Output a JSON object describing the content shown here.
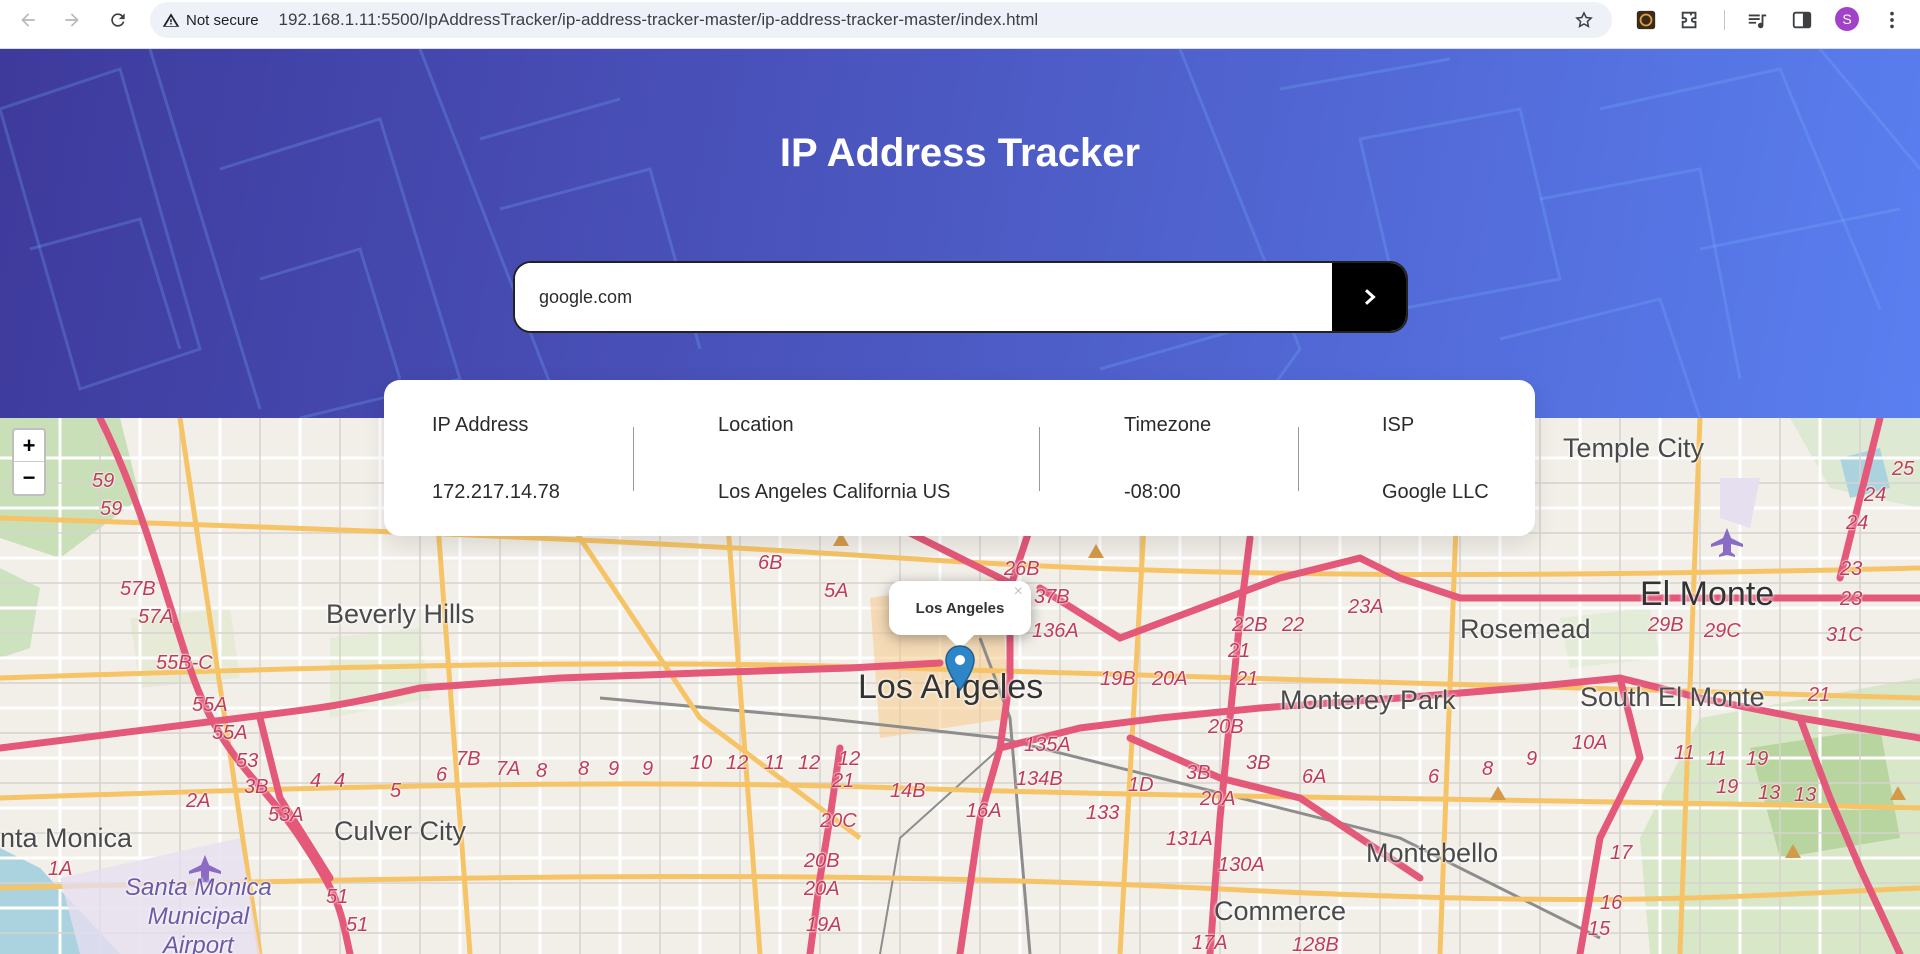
{
  "browser": {
    "security_text": "Not secure",
    "url": "192.168.1.11:5500/IpAddressTracker/ip-address-tracker-master/ip-address-tracker-master/index.html",
    "profile_initial": "S"
  },
  "header": {
    "title": "IP Address Tracker"
  },
  "search": {
    "value": "google.com"
  },
  "info": {
    "ip_label": "IP Address",
    "ip_value": "172.217.14.78",
    "location_label": "Location",
    "location_value": "Los Angeles California US",
    "timezone_label": "Timezone",
    "timezone_value": "-08:00",
    "isp_label": "ISP",
    "isp_value": "Google LLC"
  },
  "map": {
    "zoom_in": "+",
    "zoom_out": "−",
    "popup_text": "Los Angeles",
    "popup_close": "×",
    "places": {
      "beverly_hills": "Beverly Hills",
      "los_angeles": "Los Angeles",
      "culver_city": "Culver City",
      "santa_monica": "nta Monica",
      "smo_airport_1": "Santa Monica",
      "smo_airport_2": "Municipal",
      "smo_airport_3": "Airport",
      "monterey_park": "Monterey Park",
      "rosemead": "Rosemead",
      "el_monte": "El Monte",
      "south_el_monte": "South El Monte",
      "temple_city": "Temple City",
      "montebello": "Montebello",
      "commerce": "Commerce"
    },
    "road_labels": [
      "59",
      "59",
      "57B",
      "57A",
      "55B-C",
      "55A",
      "55A",
      "53",
      "3B",
      "53A",
      "2A",
      "1A",
      "4",
      "4",
      "5",
      "6",
      "7B",
      "7A",
      "8",
      "8",
      "9",
      "9",
      "10",
      "12",
      "11",
      "12",
      "12",
      "21",
      "6B",
      "5A",
      "26B",
      "37B",
      "136A",
      "14B",
      "20C",
      "20B",
      "20A",
      "19A",
      "16A",
      "135A",
      "134B",
      "133",
      "1D",
      "3B",
      "3B",
      "6A",
      "6",
      "8",
      "9",
      "20B",
      "20A",
      "131A",
      "130A",
      "17A",
      "128B",
      "22B",
      "22",
      "21",
      "21",
      "19B",
      "20A",
      "23A",
      "29B",
      "29C",
      "31C",
      "25",
      "24",
      "24",
      "23",
      "23",
      "21",
      "10A",
      "11",
      "11",
      "19",
      "19",
      "13",
      "13",
      "17",
      "16",
      "15",
      "51",
      "51"
    ]
  },
  "colors": {
    "header_start": "#3e3a9c",
    "header_end": "#5a7ff0",
    "button": "#000000",
    "text_dark": "#2b2b2b",
    "road_pink": "#e4587a",
    "road_orange": "#f6c466"
  },
  "icons": [
    "back-arrow-icon",
    "forward-arrow-icon",
    "reload-icon",
    "warning-triangle-icon",
    "bookmark-star-icon",
    "extension-icon",
    "puzzle-icon",
    "media-icon",
    "sidepanel-icon",
    "kebab-menu-icon",
    "chevron-right-icon",
    "map-marker-icon",
    "airport-icon"
  ]
}
